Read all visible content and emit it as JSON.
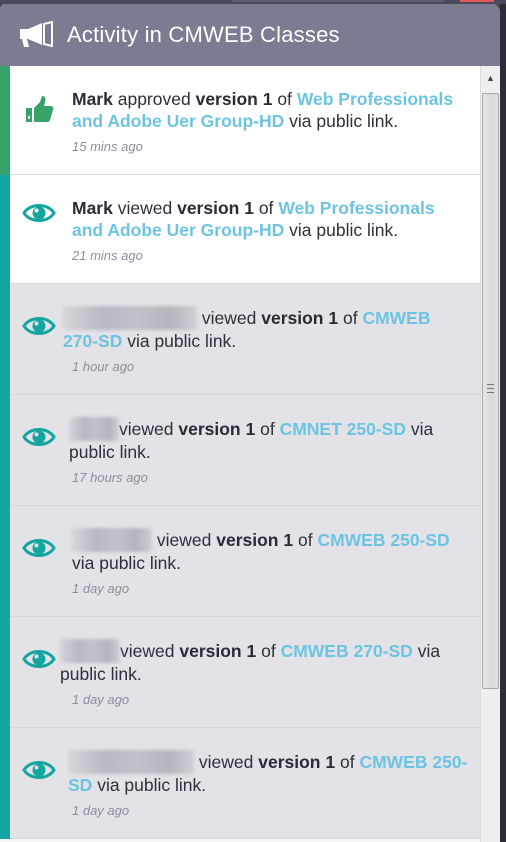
{
  "panel": {
    "title": "Activity in CMWEB Classes",
    "title_icon": "megaphone-icon",
    "colors": {
      "header_bg": "#7b7b92",
      "approved_accent": "#35a36a",
      "viewed_accent": "#13a6a0",
      "link": "#6cc4e2",
      "unread_bg": "#ffffff",
      "read_bg": "#e2e2e7"
    }
  },
  "activities": [
    {
      "icon": "thumbs-up-icon",
      "type": "approved",
      "user": "Mark",
      "user_redacted": false,
      "action": "approved",
      "version": "version 1",
      "of": "of",
      "target": "Web Professionals and Adobe Uer Group-HD",
      "suffix": "via public link.",
      "time": "15 mins ago"
    },
    {
      "icon": "eye-icon",
      "type": "viewed",
      "user": "Mark",
      "user_redacted": false,
      "action": "viewed",
      "version": "version 1",
      "of": "of",
      "target": "Web Professionals and Adobe Uer Group-HD",
      "suffix": "via public link.",
      "time": "21 mins ago"
    },
    {
      "icon": "eye-icon",
      "type": "viewed",
      "user": "",
      "user_redacted": true,
      "action": "viewed",
      "version": "version 1",
      "of": "of",
      "target": "CMWEB 270-SD",
      "suffix": "via public link.",
      "time": "1 hour ago"
    },
    {
      "icon": "eye-icon",
      "type": "viewed",
      "user": "",
      "user_redacted": true,
      "action": "viewed",
      "version": "version 1",
      "of": "of",
      "target": "CMNET 250-SD",
      "suffix": "via public link.",
      "time": "17 hours ago"
    },
    {
      "icon": "eye-icon",
      "type": "viewed",
      "user": "",
      "user_redacted": true,
      "action": "viewed",
      "version": "version 1",
      "of": "of",
      "target": "CMWEB 250-SD",
      "suffix": "via public link.",
      "time": "1 day ago"
    },
    {
      "icon": "eye-icon",
      "type": "viewed",
      "user": "",
      "user_redacted": true,
      "action": "viewed",
      "version": "version 1",
      "of": "of",
      "target": "CMWEB 270-SD",
      "suffix": "via public link.",
      "time": "1 day ago"
    },
    {
      "icon": "eye-icon",
      "type": "viewed",
      "user": "",
      "user_redacted": true,
      "action": "viewed",
      "version": "version 1",
      "of": "of",
      "target": "CMWEB 250-SD",
      "suffix": "via public link.",
      "time": "1 day ago"
    }
  ]
}
